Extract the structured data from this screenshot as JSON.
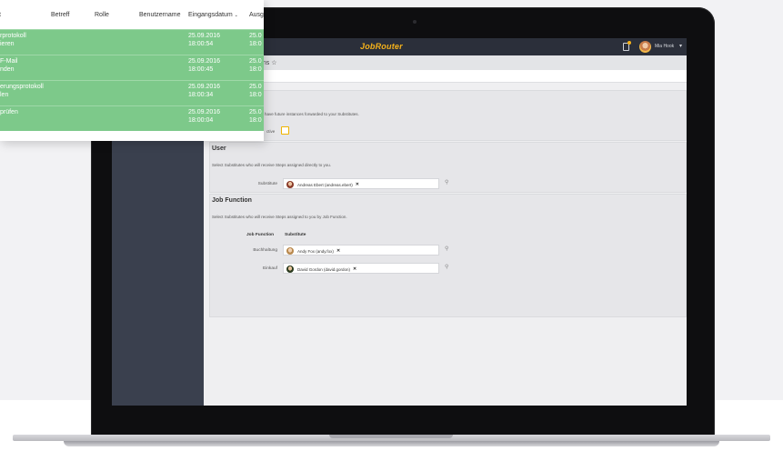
{
  "app": {
    "brand": "JobRouter",
    "user_name": "Mia Hook",
    "page_title": "ons ☆"
  },
  "settings": {
    "intro_text": "have future instances forwarded to your Substitutes.",
    "active_label": "ctive",
    "user_section": {
      "title": "User",
      "description": "Select Substitutes who will receive Steps assigned directly to you.",
      "substitute_label": "Substitute",
      "substitute_value": "Andreas Ebert (andreas.ebert)"
    },
    "job_function_section": {
      "title": "Job Function",
      "description": "Select Substitutes who will receive Steps assigned to you by Job Function.",
      "col_job_function": "Job Function",
      "col_substitute": "Substitute",
      "rows": [
        {
          "job_function": "Buchhaltung",
          "substitute": "Andy Fox (andy.fox)"
        },
        {
          "job_function": "Einkauf",
          "substitute": "David Gordon (david.gordon)"
        }
      ]
    }
  },
  "inbox": {
    "columns": [
      "t",
      "Betreff",
      "Rolle",
      "Benutzername",
      "Eingangsdatum",
      "Ausg"
    ],
    "rows": [
      {
        "step_l1": "rprotokoll",
        "step_l2": "ieren",
        "date": "25.09.2016",
        "time": "18:00:54",
        "out_date": "25.0",
        "out_time": "18:0"
      },
      {
        "step_l1": "F-Mail",
        "step_l2": "nden",
        "date": "25.09.2016",
        "time": "18:00:45",
        "out_date": "25.0",
        "out_time": "18:0"
      },
      {
        "step_l1": "erungsprotokoll",
        "step_l2": "len",
        "date": "25.09.2016",
        "time": "18:00:34",
        "out_date": "25.0",
        "out_time": "18:0"
      },
      {
        "step_l1": "prüfen",
        "step_l2": "",
        "date": "25.09.2016",
        "time": "18:00:04",
        "out_date": "25.0",
        "out_time": "18:0"
      }
    ]
  },
  "colors": {
    "accent": "#f6b21a",
    "row_green": "#7dc98a",
    "topbar": "#2b2f3a",
    "sidebar": "#3a404e"
  },
  "icons": [
    "notification-icon",
    "avatar",
    "caret-down-icon",
    "search-icon",
    "remove-icon",
    "star-icon",
    "sort-caret-icon"
  ]
}
